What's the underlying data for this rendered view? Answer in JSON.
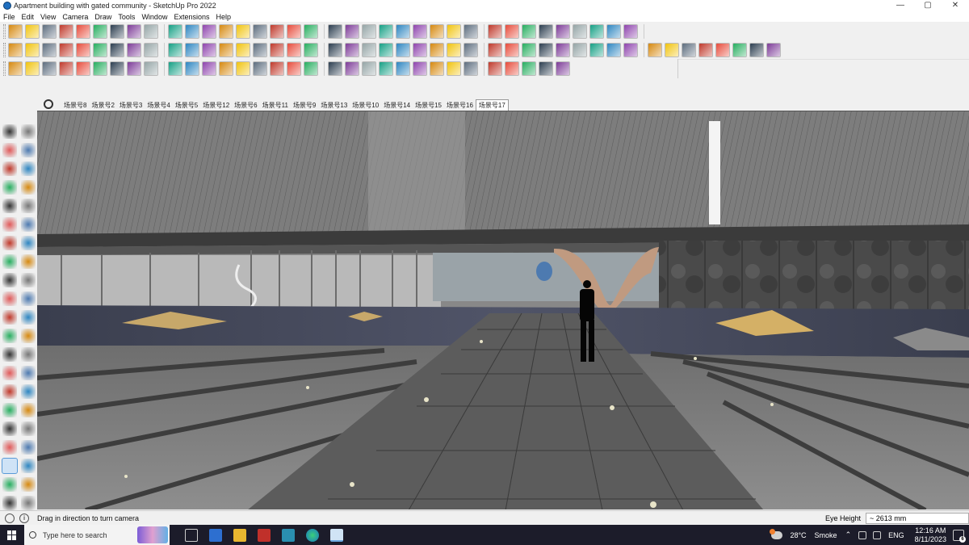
{
  "window": {
    "title": "Apartment building with gated community - SketchUp Pro 2022",
    "controls": {
      "minimize": "—",
      "maximize": "▢",
      "close": "✕"
    }
  },
  "menu": [
    "File",
    "Edit",
    "View",
    "Camera",
    "Draw",
    "Tools",
    "Window",
    "Extensions",
    "Help"
  ],
  "scenes": {
    "tabs": [
      "场景号8",
      "场景号2",
      "场景号3",
      "场景号4",
      "场景号5",
      "场景号12",
      "场景号6",
      "场景号11",
      "场景号9",
      "场景号13",
      "场景号10",
      "场景号14",
      "场景号15",
      "场景号16",
      "场景号17"
    ],
    "active_index": 14
  },
  "status": {
    "hint": "Drag in direction to turn camera",
    "measure_label": "Eye Height",
    "measure_value": "~ 2613 mm"
  },
  "taskbar": {
    "search_placeholder": "Type here to search",
    "weather_temp": "28°C",
    "weather_desc": "Smoke",
    "language": "ENG",
    "time": "12:16 AM",
    "date": "8/11/2023",
    "notification_count": "6"
  },
  "colors": {
    "accent": "#1f6fbf",
    "taskbar": "#1c1c2a"
  }
}
